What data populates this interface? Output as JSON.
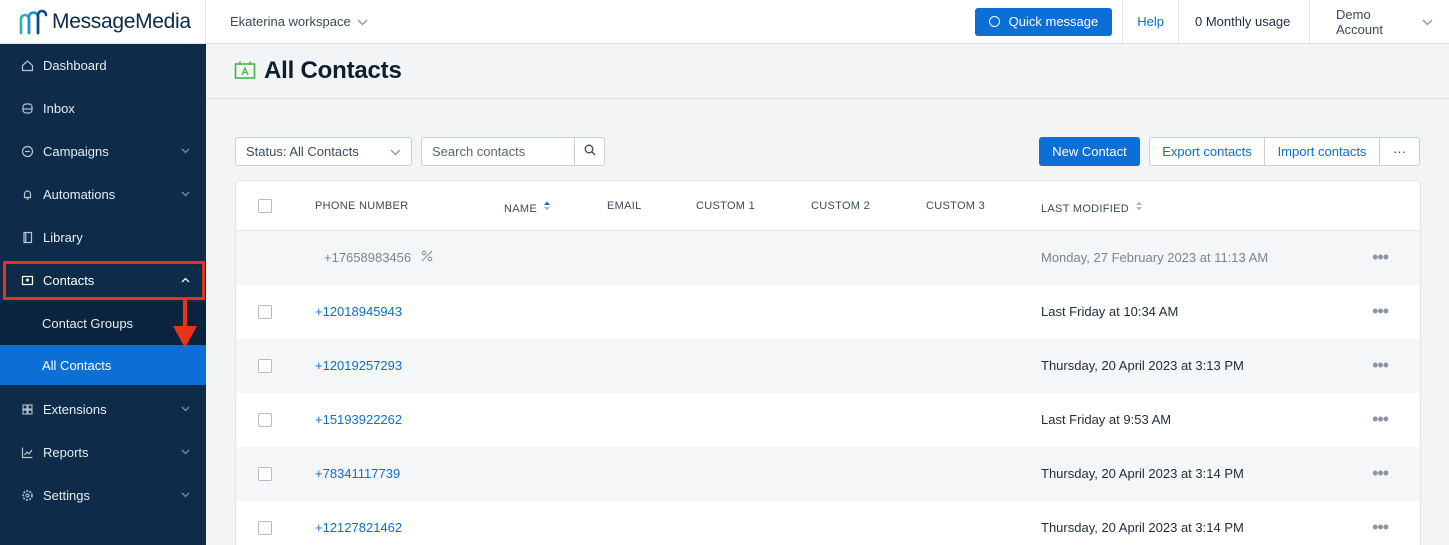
{
  "brand": {
    "name": "MessageMedia",
    "accent": "#0c6fd6",
    "sidebar_bg": "#0e2c4a",
    "highlight": "#e8321a"
  },
  "topbar": {
    "workspace": "Ekaterina workspace",
    "quick_message": "Quick message",
    "help": "Help",
    "usage": "0 Monthly usage",
    "account": "Demo Account"
  },
  "sidebar": {
    "items": [
      {
        "label": "Dashboard",
        "icon": "home-icon"
      },
      {
        "label": "Inbox",
        "icon": "inbox-icon"
      },
      {
        "label": "Campaigns",
        "icon": "chat-icon"
      },
      {
        "label": "Automations",
        "icon": "bell-icon"
      },
      {
        "label": "Library",
        "icon": "book-icon"
      },
      {
        "label": "Contacts",
        "icon": "contact-card-icon"
      },
      {
        "label": "Contact Groups"
      },
      {
        "label": "All Contacts"
      },
      {
        "label": "Extensions",
        "icon": "grid-icon"
      },
      {
        "label": "Reports",
        "icon": "chart-icon"
      },
      {
        "label": "Settings",
        "icon": "gear-icon"
      }
    ]
  },
  "page": {
    "title": "All Contacts"
  },
  "toolbar": {
    "status_filter": "Status: All Contacts",
    "search_placeholder": "Search contacts",
    "new_contact": "New Contact",
    "export": "Export contacts",
    "import": "Import contacts",
    "more": "···"
  },
  "table": {
    "columns": [
      "PHONE NUMBER",
      "NAME",
      "EMAIL",
      "CUSTOM 1",
      "CUSTOM 2",
      "CUSTOM 3",
      "LAST MODIFIED"
    ],
    "rows": [
      {
        "phone": "+17658983456",
        "modified": "Monday, 27 February 2023 at 11:13 AM",
        "opted_out": true
      },
      {
        "phone": "+12018945943",
        "modified": "Last Friday at 10:34 AM"
      },
      {
        "phone": "+12019257293",
        "modified": "Thursday, 20 April 2023 at 3:13 PM"
      },
      {
        "phone": "+15193922262",
        "modified": "Last Friday at 9:53 AM"
      },
      {
        "phone": "+78341117739",
        "modified": "Thursday, 20 April 2023 at 3:14 PM"
      },
      {
        "phone": "+12127821462",
        "modified": "Thursday, 20 April 2023 at 3:14 PM"
      }
    ],
    "row_menu": "•••"
  }
}
